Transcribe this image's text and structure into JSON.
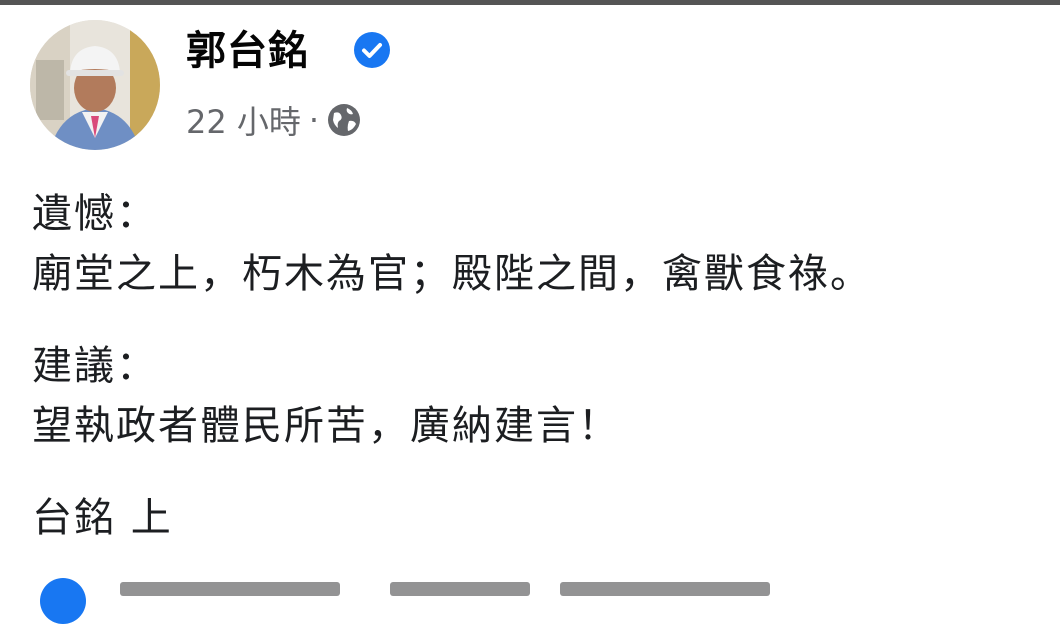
{
  "post": {
    "author": "郭台銘",
    "timestamp": "22 小時",
    "separator": "·",
    "lines": [
      "遺憾：",
      "廟堂之上，朽木為官；殿陛之間，禽獸食祿。",
      "建議：",
      "望執政者體民所苦，廣納建言！",
      "台銘 上"
    ]
  },
  "icons": {
    "verified": "verified-badge-icon",
    "audience": "globe-icon",
    "footer": "facebook-icon"
  },
  "colors": {
    "name": "#050505",
    "text": "#1c1e21",
    "meta": "#65676b",
    "verified": "#1877f2"
  }
}
